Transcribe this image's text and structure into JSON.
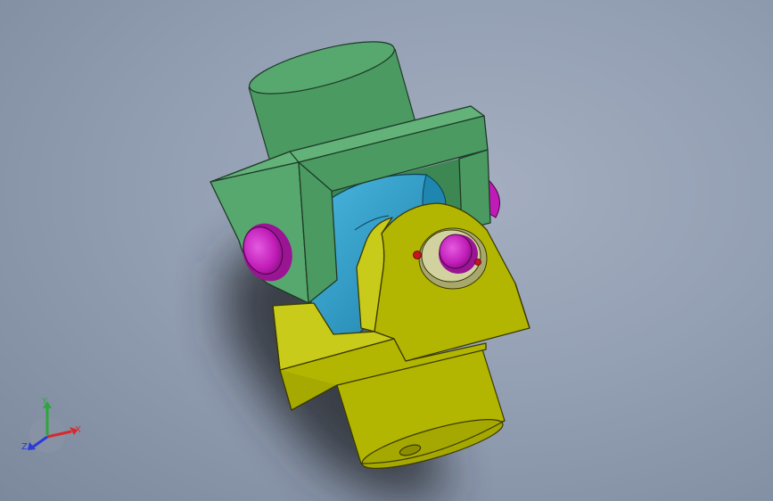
{
  "viewport": {
    "background_color": "#939fb3"
  },
  "model": {
    "parts": [
      {
        "name": "upper-hub",
        "color": "#4a9a62"
      },
      {
        "name": "upper-yoke",
        "color": "#4a9a62"
      },
      {
        "name": "cross-spider",
        "color": "#2d9dc6"
      },
      {
        "name": "lower-yoke",
        "color": "#b3b600"
      },
      {
        "name": "lower-hub",
        "color": "#b3b600"
      },
      {
        "name": "pin-caps",
        "color": "#c01ab8"
      },
      {
        "name": "bushing",
        "color": "#d2d2a0"
      },
      {
        "name": "set-screws",
        "color": "#c8141e"
      }
    ]
  },
  "triad": {
    "x_label": "X",
    "y_label": "Y",
    "z_label": "Z",
    "x_color": "#d8282c",
    "y_color": "#2aa83a",
    "z_color": "#2a3ad8"
  }
}
